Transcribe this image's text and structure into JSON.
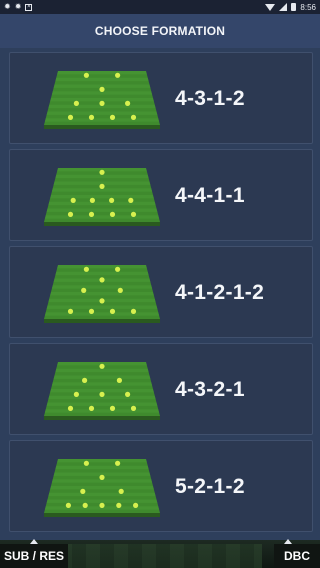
{
  "status_bar": {
    "left_icons": [
      "bug-icon",
      "bug-icon",
      "notification-box-icon"
    ],
    "time": "8:56"
  },
  "header": {
    "title": "CHOOSE FORMATION"
  },
  "formations": [
    {
      "label": "4-3-1-2"
    },
    {
      "label": "4-4-1-1"
    },
    {
      "label": "4-1-2-1-2"
    },
    {
      "label": "4-3-2-1"
    },
    {
      "label": "5-2-1-2"
    }
  ],
  "bottom_bar": {
    "left_button": "SUB / RES",
    "right_button": "DBC"
  },
  "colors": {
    "background": "#2e3f5c",
    "card": "#2c3952",
    "header": "#34466a",
    "pitch_green": "#3f8a2d",
    "player_dot": "#d7f04f"
  }
}
